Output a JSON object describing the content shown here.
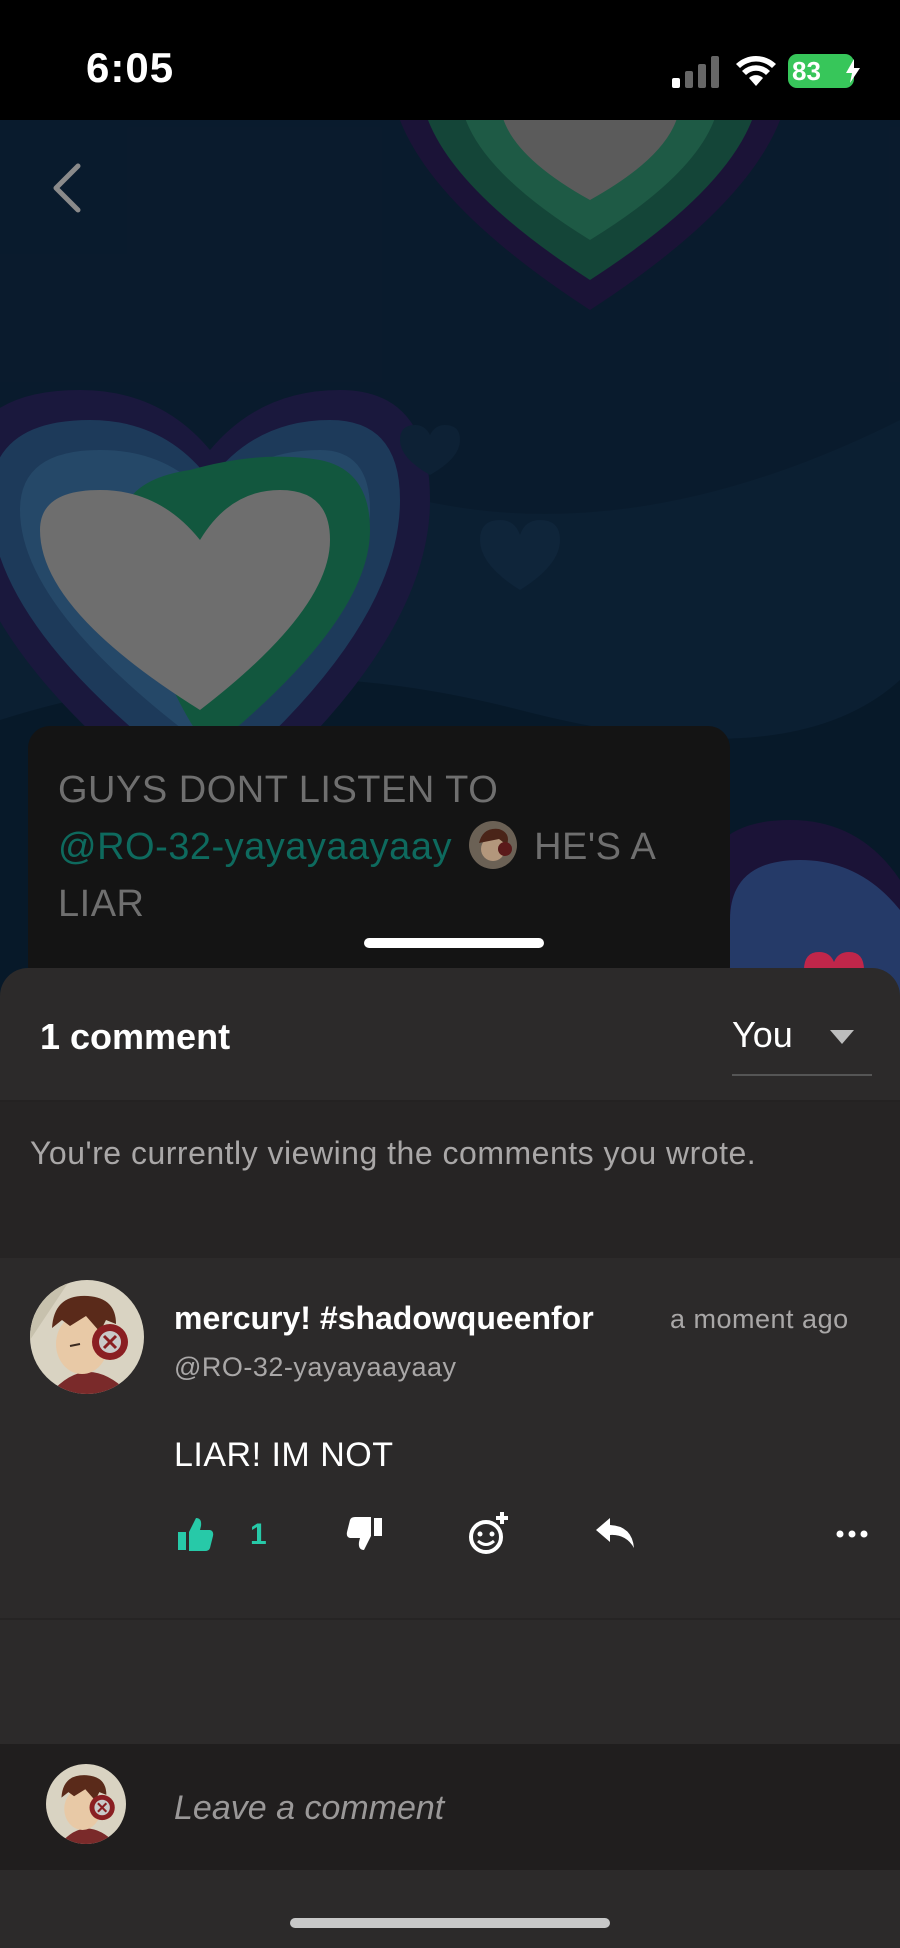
{
  "status_bar": {
    "time": "6:05",
    "battery": "83"
  },
  "post": {
    "text_before": "GUYS DONT LISTEN TO",
    "mention": "@RO-32-yayayaayaay",
    "text_after": "HE'S A LIAR"
  },
  "comments_panel": {
    "count_label": "1 comment",
    "filter_label": "You",
    "notice": "You're currently viewing the comments you wrote.",
    "comments": [
      {
        "display_name": "mercury! #shadowqueenfor",
        "handle": "@RO-32-yayayaayaay",
        "time": "a moment ago",
        "body": "LIAR! IM NOT",
        "likes": "1"
      }
    ],
    "composer_placeholder": "Leave a comment"
  },
  "colors": {
    "accent": "#27c9a8",
    "sheet_bg": "#2c2a2a",
    "mention": "#0e6a5e"
  },
  "icons": {
    "back": "chevron-left-icon",
    "like": "thumbs-up-icon",
    "dislike": "thumbs-down-icon",
    "react": "add-emoji-icon",
    "reply": "reply-icon",
    "more": "more-icon"
  }
}
